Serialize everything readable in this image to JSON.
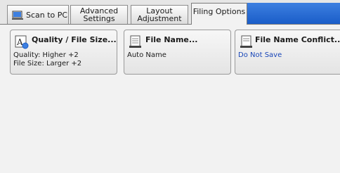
{
  "tabs": [
    {
      "label": "Scan to PC",
      "icon": "scan-to-pc-icon"
    },
    {
      "label": "Advanced\nSettings"
    },
    {
      "label": "Layout\nAdjustment"
    },
    {
      "label": "Filing Options"
    }
  ],
  "cards": {
    "quality": {
      "title": "Quality / File Size...",
      "icon": "quality-filesize-icon",
      "line1": "Quality: Higher +2",
      "line2": "File Size: Larger +2"
    },
    "file_name": {
      "title": "File Name...",
      "icon": "file-name-icon",
      "value": "Auto Name"
    },
    "conflict": {
      "title": "File Name Conflict...",
      "icon": "file-name-conflict-icon",
      "value": "Do Not Save"
    }
  },
  "colors": {
    "accent": "#1a5dc8",
    "value_highlight": "#1846b8"
  }
}
